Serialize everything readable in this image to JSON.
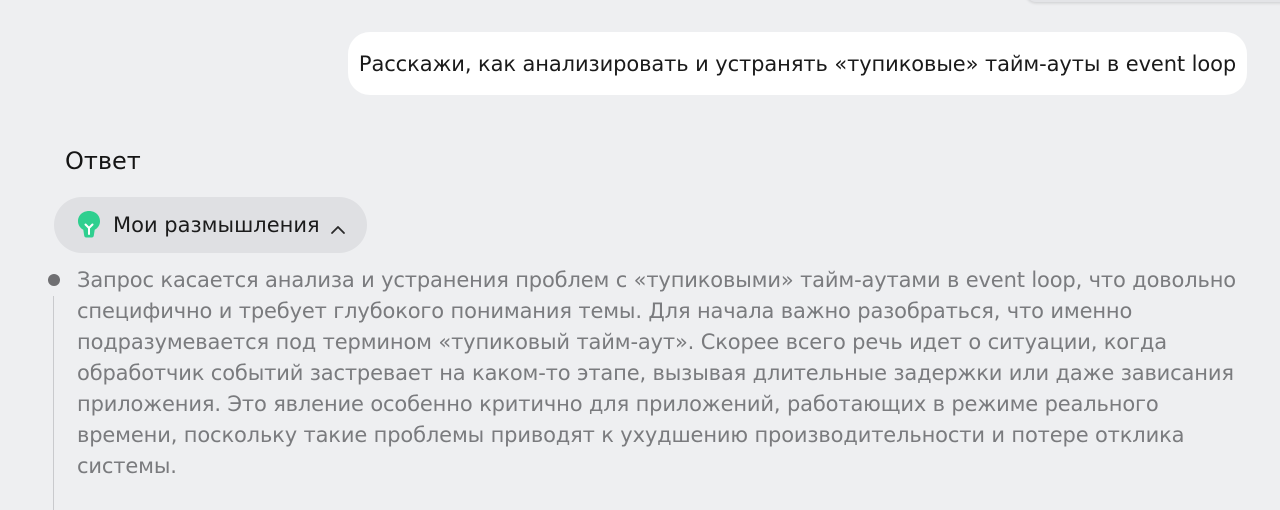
{
  "colors": {
    "background": "#eeeff1",
    "user_bubble": "#ffffff",
    "toggle_background": "#dfe0e3",
    "bulb_accent": "#2fcf8f",
    "thought_text": "#7a7b7e"
  },
  "user_message": {
    "text": "Расскажи, как анализировать и устранять «тупиковые» тайм-ауты в event loop"
  },
  "answer": {
    "heading": "Ответ",
    "thoughts_toggle": {
      "label": "Мои размышления",
      "icon": "lightbulb-icon",
      "chevron_icon": "chevron-up-icon"
    },
    "thought": {
      "text": "Запрос касается анализа и устранения проблем с «тупиковыми» тайм-аутами в event loop, что довольно специфично и требует глубокого понимания темы. Для начала важно разобраться, что именно подразумевается под термином «тупиковый тайм-аут». Скорее всего речь идет о ситуации, когда обработчик событий застревает на каком-то этапе, вызывая длительные задержки или даже зависания приложения. Это явление особенно критично для приложений, работающих в режиме реального времени, поскольку такие проблемы приводят к ухудшению производительности и потере отклика системы."
    }
  }
}
